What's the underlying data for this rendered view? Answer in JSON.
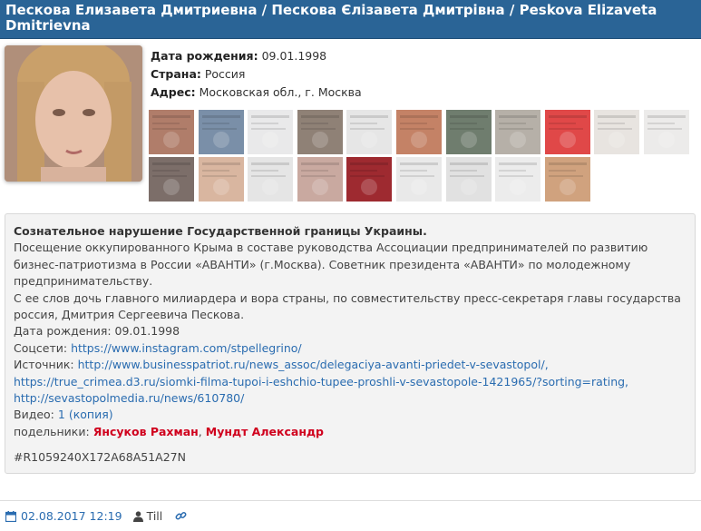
{
  "header": {
    "title": "Пескова Елизавета Дмитриевна / Пескова Єлізавета Дмитрівна / Peskova Elizaveta Dmitrievna"
  },
  "profile": {
    "birth_label": "Дата рождения:",
    "birth_value": "09.01.1998",
    "country_label": "Страна:",
    "country_value": "Россия",
    "address_label": "Адрес:",
    "address_value": "Московская обл., г. Москва"
  },
  "gallery": {
    "thumbnails": [
      {
        "color": "#b07d6a"
      },
      {
        "color": "#7a8fa8"
      },
      {
        "color": "#e9e9ea"
      },
      {
        "color": "#8f8176"
      },
      {
        "color": "#e6e6e6"
      },
      {
        "color": "#c48266"
      },
      {
        "color": "#6f7d6e"
      },
      {
        "color": "#b6b0a8"
      },
      {
        "color": "#e04848"
      },
      {
        "color": "#e8e4e0"
      },
      {
        "color": "#ecebea"
      },
      {
        "color": "#7c6e69"
      },
      {
        "color": "#d9b6a0"
      },
      {
        "color": "#e5e5e5"
      },
      {
        "color": "#c9a9a0"
      },
      {
        "color": "#9e2a30"
      },
      {
        "color": "#e9e9e9"
      },
      {
        "color": "#e1e1e1"
      },
      {
        "color": "#ececec"
      },
      {
        "color": "#d0a27e"
      }
    ]
  },
  "details": {
    "title": "Сознательное нарушение Государственной границы Украины.",
    "line1": "Посещение оккупированного Крыма в составе руководства Ассоциации предпринимателей по развитию бизнес-патриотизма в России «АВАНТИ» (г.Москва). Советник президента «АВАНТИ» по молодежному предпринимательству.",
    "line2": "С ее слов дочь главного милиардера и вора страны, по совместительству пресс-секретаря главы государства россия, Дмитрия Сергеевича Пескова.",
    "birth": "Дата рождения: 09.01.1998",
    "social_label": "Соцсети:",
    "social_link": "https://www.instagram.com/stpellegrino/",
    "source_label": "Источник:",
    "source_links": [
      "http://www.businesspatriot.ru/news_assoc/delegaciya-avanti-priedet-v-sevastopol/,",
      "https://true_crimea.d3.ru/siomki-filma-tupoi-i-eshchio-tupee-proshli-v-sevastopole-1421965/?sorting=rating,",
      "http://sevastopolmedia.ru/news/610780/"
    ],
    "video_label": "Видео:",
    "video_count": "1",
    "video_copy": "(копия)",
    "accomplices_label": "подельники:",
    "accomplice1": "Янсуков Рахман",
    "separator": ",",
    "accomplice2": "Мундт Александр",
    "hash": "#R1059240X172A68A51A27N"
  },
  "footer": {
    "date": "02.08.2017 12:19",
    "author": "Till"
  },
  "colors": {
    "header_bg": "#2a6496",
    "link": "#2a6cb0",
    "accent_red": "#d0001d"
  }
}
